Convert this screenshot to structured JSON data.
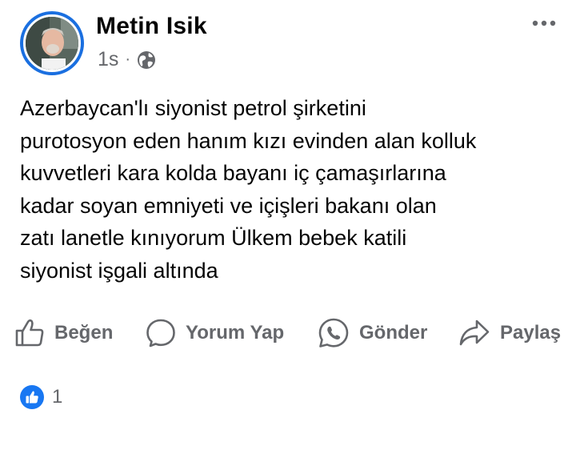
{
  "post": {
    "author": "Metin Isik",
    "time": "1s",
    "separator": "·",
    "audience_icon": "globe-icon",
    "text_lines": [
      "Azerbaycan'lı siyonist petrol şirketini",
      "purotosyon eden hanım kızı evinden alan kolluk",
      "kuvvetleri kara kolda bayanı iç çamaşırlarına",
      "kadar soyan emniyeti ve içişleri bakanı olan",
      "zatı lanetle kınıyorum Ülkem bebek katili",
      "siyonist işgali altında"
    ]
  },
  "actions": {
    "like": "Beğen",
    "comment": "Yorum Yap",
    "send": "Gönder",
    "share": "Paylaş"
  },
  "reactions": {
    "icon": "like-reaction-icon",
    "count": "1"
  },
  "colors": {
    "text": "#050505",
    "secondary": "#65676b",
    "accent": "#1877f2",
    "avatar_ring": "#1a6fe0"
  }
}
